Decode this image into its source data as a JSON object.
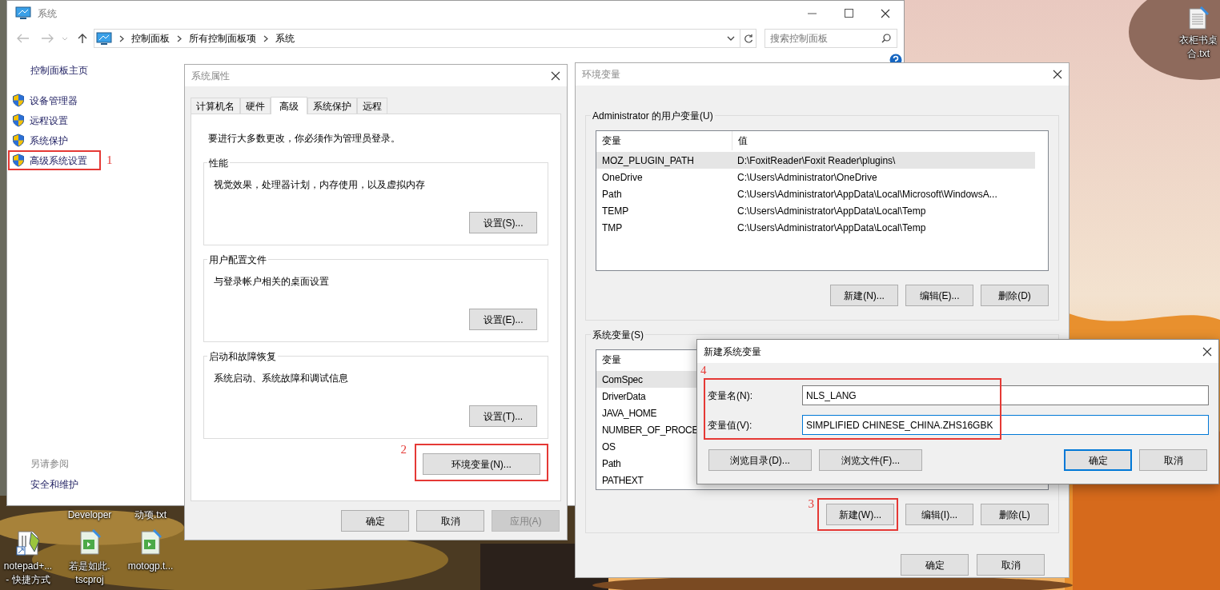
{
  "desktop": {
    "cut_labels": [
      {
        "text": "Developer"
      },
      {
        "text": "动项.txt"
      }
    ],
    "icons": [
      {
        "kind": "notepad",
        "lines": [
          "notepad+...",
          "- 快捷方式"
        ]
      },
      {
        "kind": "video_project",
        "lines": [
          "若是如此.",
          "tscproj"
        ]
      },
      {
        "kind": "video_project",
        "lines": [
          "motogp.t..."
        ]
      },
      {
        "kind": "text_file",
        "lines": [
          "衣柜书桌",
          "合.txt"
        ]
      }
    ]
  },
  "control_panel": {
    "title": "系统",
    "breadcrumbs": [
      "控制面板",
      "所有控制面板项",
      "系统"
    ],
    "search": {
      "placeholder": "搜索控制面板"
    },
    "sidebar": {
      "home": "控制面板主页",
      "items": [
        {
          "label": "设备管理器"
        },
        {
          "label": "远程设置"
        },
        {
          "label": "系统保护"
        },
        {
          "label": "高级系统设置",
          "callout": "1"
        }
      ],
      "see_also": {
        "heading": "另请参阅",
        "links": [
          "安全和维护"
        ]
      }
    }
  },
  "system_properties": {
    "title": "系统属性",
    "tabs": [
      {
        "label": "计算机名",
        "selected": false
      },
      {
        "label": "硬件",
        "selected": false
      },
      {
        "label": "高级",
        "selected": true
      },
      {
        "label": "系统保护",
        "selected": false
      },
      {
        "label": "远程",
        "selected": false
      }
    ],
    "notice": "要进行大多数更改，你必须作为管理员登录。",
    "groups": [
      {
        "title": "性能",
        "description": "视觉效果，处理器计划，内存使用，以及虚拟内存",
        "button": "设置(S)..."
      },
      {
        "title": "用户配置文件",
        "description": "与登录帐户相关的桌面设置",
        "button": "设置(E)..."
      },
      {
        "title": "启动和故障恢复",
        "description": "系统启动、系统故障和调试信息",
        "button": "设置(T)..."
      }
    ],
    "env_button": {
      "label": "环境变量(N)...",
      "callout": "2"
    },
    "buttons": [
      {
        "label": "确定",
        "disabled": false
      },
      {
        "label": "取消",
        "disabled": false
      },
      {
        "label": "应用(A)",
        "disabled": true
      }
    ]
  },
  "environment_variables": {
    "title": "环境变量",
    "user_variables": {
      "heading": "Administrator 的用户变量(U)",
      "columns": [
        "变量",
        "值"
      ],
      "rows": [
        {
          "name": "MOZ_PLUGIN_PATH",
          "value": "D:\\FoxitReader\\Foxit Reader\\plugins\\",
          "selected": true
        },
        {
          "name": "OneDrive",
          "value": "C:\\Users\\Administrator\\OneDrive",
          "selected": false
        },
        {
          "name": "Path",
          "value": "C:\\Users\\Administrator\\AppData\\Local\\Microsoft\\WindowsA...",
          "selected": false
        },
        {
          "name": "TEMP",
          "value": "C:\\Users\\Administrator\\AppData\\Local\\Temp",
          "selected": false
        },
        {
          "name": "TMP",
          "value": "C:\\Users\\Administrator\\AppData\\Local\\Temp",
          "selected": false
        }
      ],
      "buttons": [
        {
          "label": "新建(N)..."
        },
        {
          "label": "编辑(E)..."
        },
        {
          "label": "删除(D)"
        }
      ]
    },
    "system_variables": {
      "heading": "系统变量(S)",
      "columns": [
        "变量"
      ],
      "rows": [
        {
          "name": "ComSpec",
          "selected": true
        },
        {
          "name": "DriverData",
          "selected": false
        },
        {
          "name": "JAVA_HOME",
          "selected": false
        },
        {
          "name": "NUMBER_OF_PROCE",
          "selected": false
        },
        {
          "name": "OS",
          "selected": false
        },
        {
          "name": "Path",
          "selected": false
        },
        {
          "name": "PATHEXT",
          "selected": false
        }
      ],
      "buttons": [
        {
          "label": "新建(W)...",
          "callout": "3"
        },
        {
          "label": "编辑(I)..."
        },
        {
          "label": "删除(L)"
        }
      ]
    },
    "buttons": [
      {
        "label": "确定"
      },
      {
        "label": "取消"
      }
    ]
  },
  "new_variable": {
    "title": "新建系统变量",
    "callout": "4",
    "fields": [
      {
        "label": "变量名(N):",
        "value": "NLS_LANG",
        "focused": false
      },
      {
        "label": "变量值(V):",
        "value": "SIMPLIFIED CHINESE_CHINA.ZHS16GBK",
        "focused": true
      }
    ],
    "browse_buttons": [
      "浏览目录(D)...",
      "浏览文件(F)..."
    ],
    "buttons": [
      {
        "label": "确定",
        "default": true
      },
      {
        "label": "取消",
        "default": false
      }
    ]
  }
}
